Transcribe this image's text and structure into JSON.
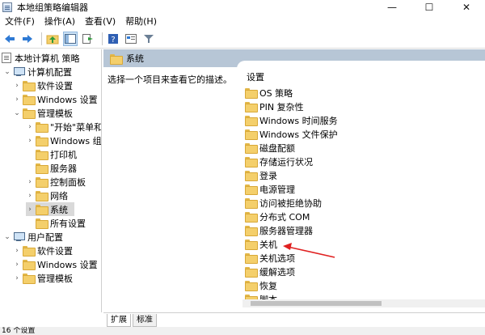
{
  "window": {
    "title": "本地组策略编辑器",
    "minimize": "—",
    "maximize": "☐",
    "close": "✕"
  },
  "menu": [
    "文件(F)",
    "操作(A)",
    "查看(V)",
    "帮助(H)"
  ],
  "toolbar_icons": [
    "back-arrow-icon",
    "forward-arrow-icon",
    "up-folder-icon",
    "show-hide-tree-icon",
    "export-list-icon",
    "help-icon",
    "properties-icon",
    "filter-icon"
  ],
  "tree": {
    "root": "本地计算机 策略",
    "computer_config": "计算机配置",
    "software_settings": "软件设置",
    "windows_settings": "Windows 设置",
    "admin_templates": "管理模板",
    "start_menu": "\"开始\"菜单和",
    "windows_components": "Windows 组",
    "printers": "打印机",
    "server": "服务器",
    "control_panel": "控制面板",
    "network": "网络",
    "system": "系统",
    "all_settings": "所有设置",
    "user_config": "用户配置",
    "user_software_settings": "软件设置",
    "user_windows_settings": "Windows 设置",
    "user_admin_templates": "管理模板"
  },
  "right": {
    "header_title": "系统",
    "description": "选择一个项目来查看它的描述。",
    "column_header": "设置",
    "items": [
      "OS 策略",
      "PIN 复杂性",
      "Windows 时间服务",
      "Windows 文件保护",
      "磁盘配额",
      "存储运行状况",
      "登录",
      "电源管理",
      "访问被拒绝协助",
      "分布式 COM",
      "服务器管理器",
      "关机",
      "关机选项",
      "缓解选项",
      "恢复",
      "脚本"
    ]
  },
  "tabs": [
    "扩展",
    "标准"
  ],
  "status": "16 个设置",
  "colors": {
    "header_bg": "#b7c6d6",
    "selected_bg": "#d9d9d9",
    "arrow": "#e02020",
    "folder": "#f4cf6b"
  }
}
